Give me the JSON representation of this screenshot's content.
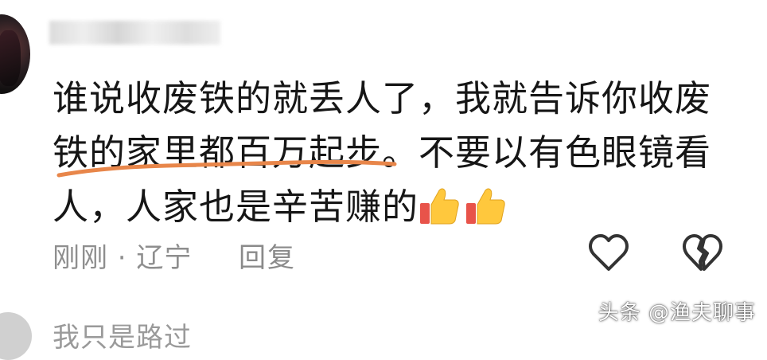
{
  "comment": {
    "lines": [
      "谁说收废铁的就丢人了，我就告诉你收废",
      "铁的家里都百万起步。不要以有色眼镜看",
      "人，人家也是辛苦赚的"
    ],
    "emojis": [
      "thumbs-up-icon",
      "thumbs-up-icon"
    ]
  },
  "meta": {
    "time_location": "刚刚 · 辽宁",
    "reply_label": "回复"
  },
  "icons": {
    "like": "heart-outline-icon",
    "dislike": "broken-heart-icon"
  },
  "colors": {
    "underline": "#e8864a",
    "text": "#161616",
    "meta": "#8e8e8e"
  },
  "watermark": "头条 @渔夫聊事",
  "next_comment": "我只是路过"
}
